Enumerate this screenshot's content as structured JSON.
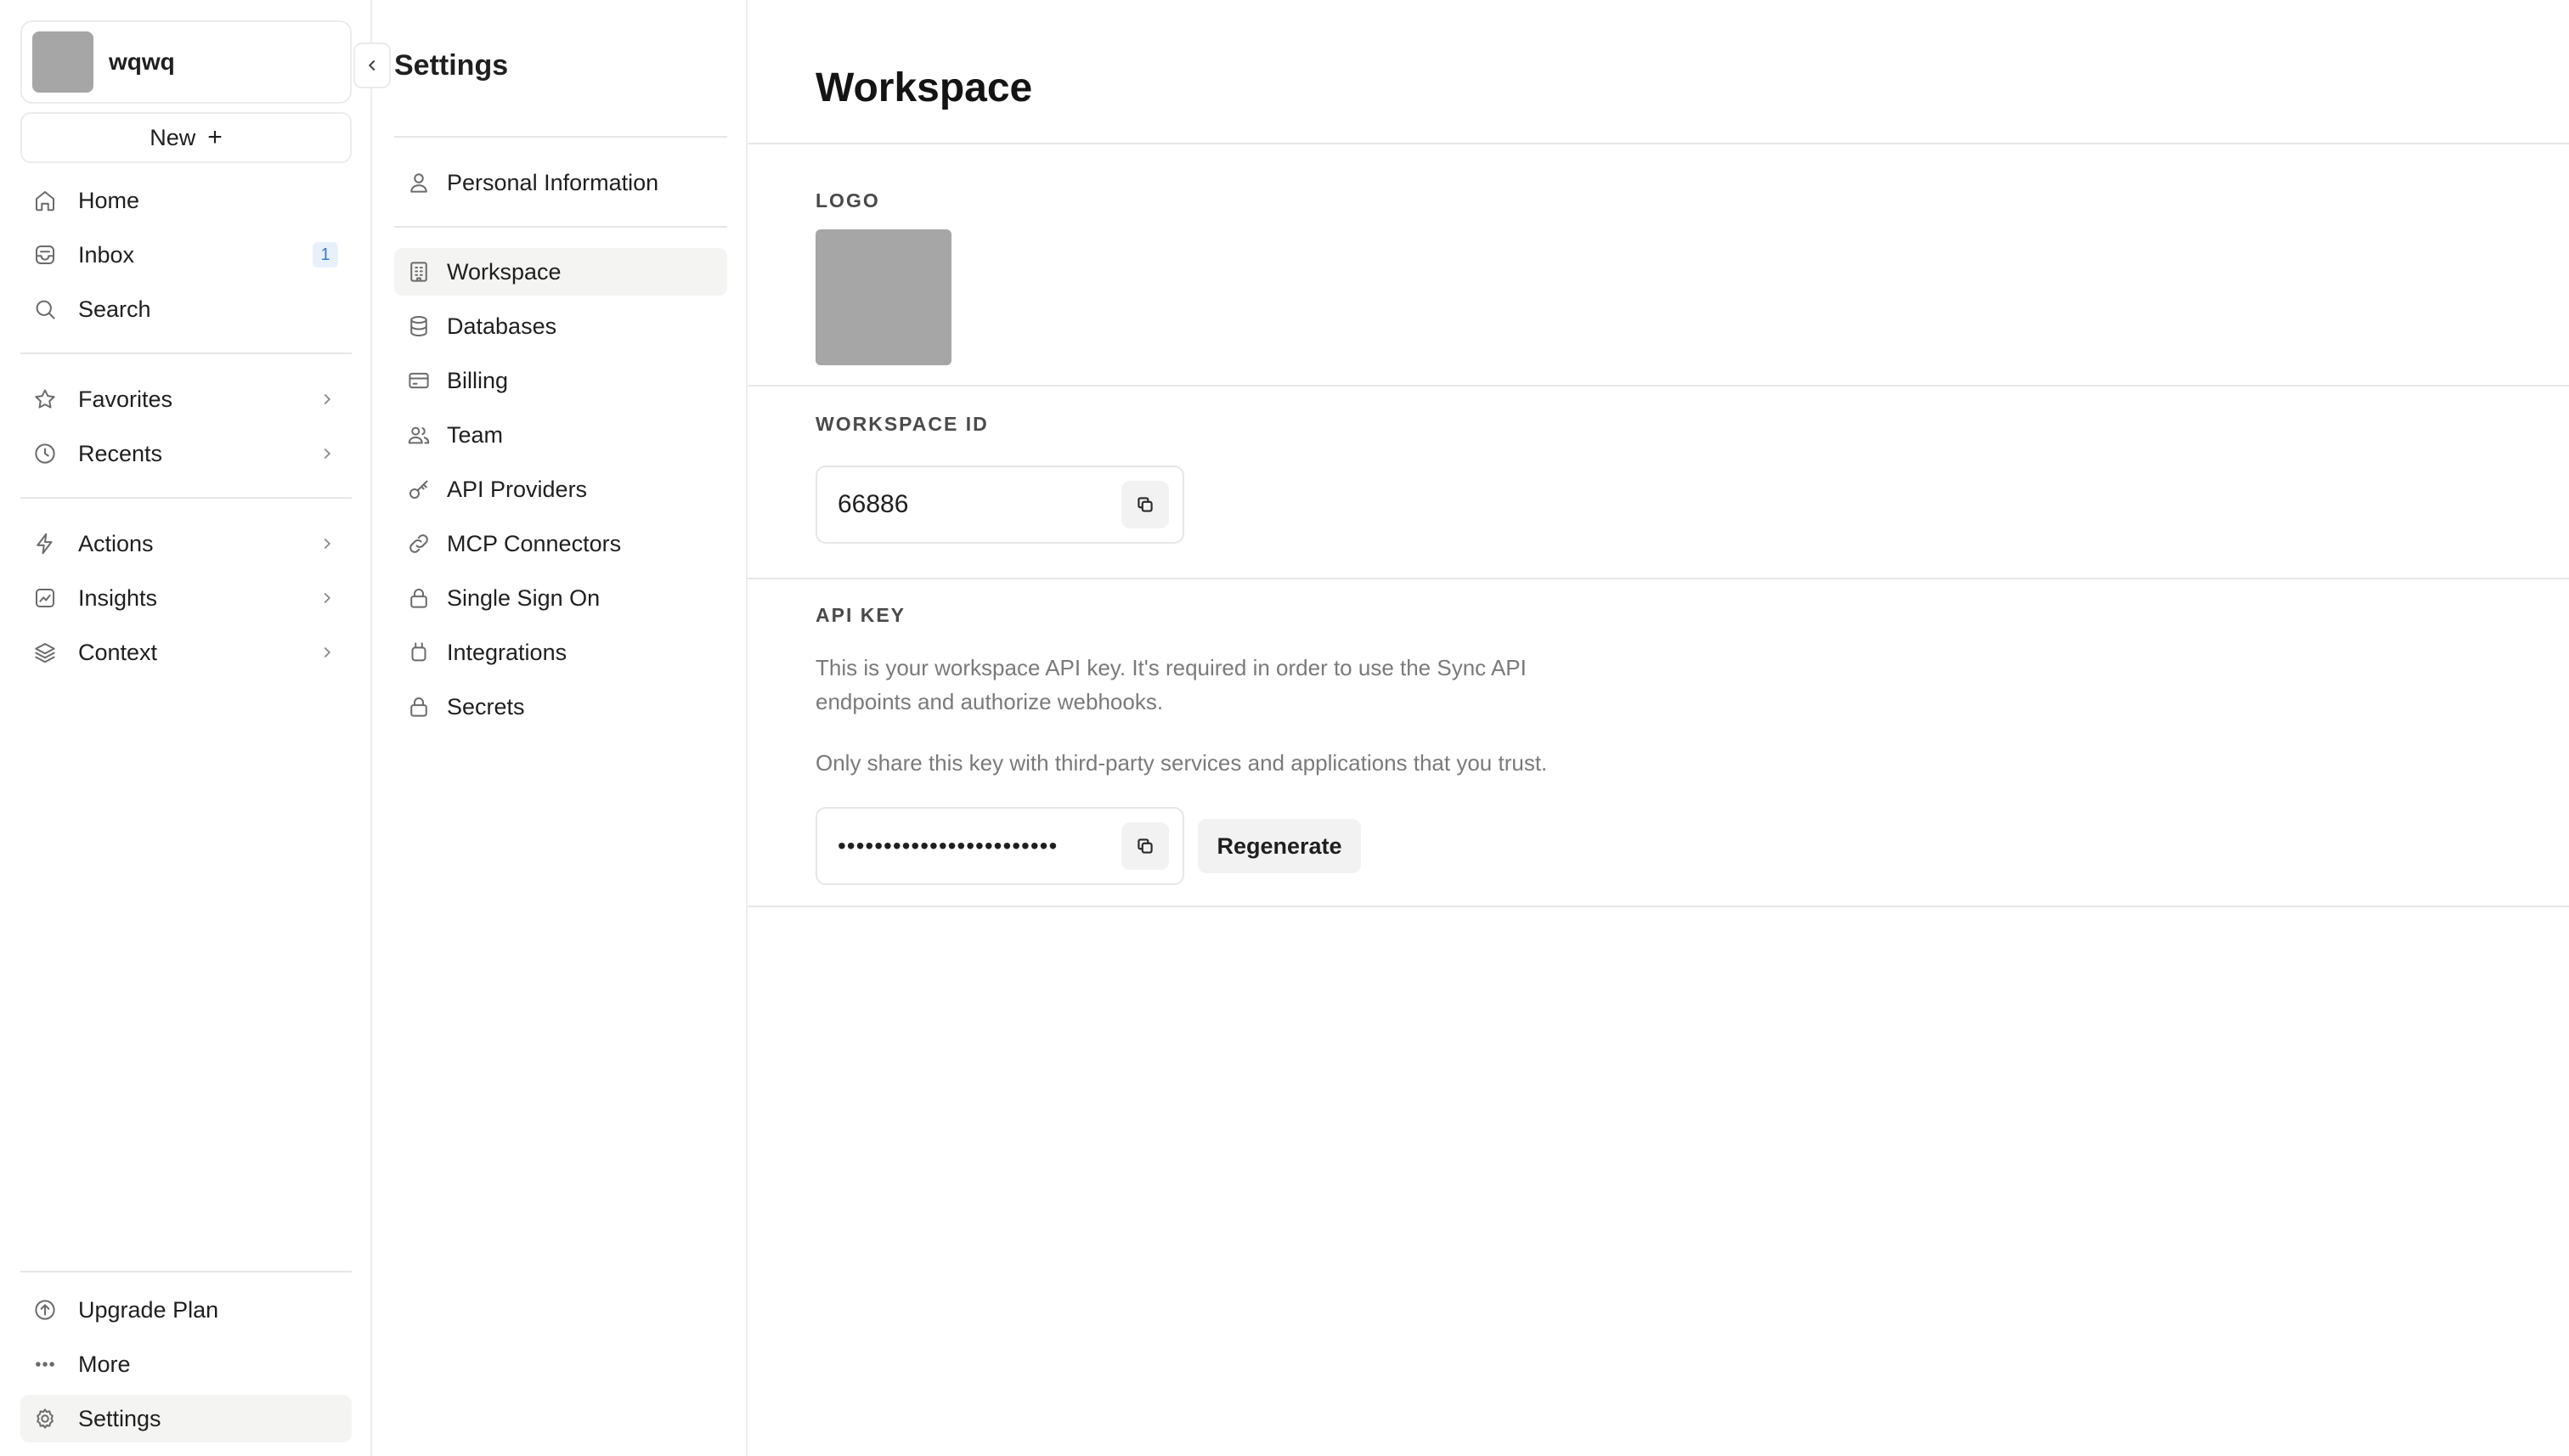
{
  "sidebar": {
    "workspace_name": "wqwq",
    "new_label": "New",
    "new_plus": "+",
    "primary": [
      {
        "label": "Home",
        "icon": "home-icon"
      },
      {
        "label": "Inbox",
        "icon": "inbox-icon",
        "badge": "1"
      },
      {
        "label": "Search",
        "icon": "search-icon"
      }
    ],
    "secondary": [
      {
        "label": "Favorites",
        "icon": "star-icon"
      },
      {
        "label": "Recents",
        "icon": "clock-icon"
      }
    ],
    "tertiary": [
      {
        "label": "Actions",
        "icon": "lightning-icon"
      },
      {
        "label": "Insights",
        "icon": "chart-icon"
      },
      {
        "label": "Context",
        "icon": "layers-icon"
      }
    ],
    "bottom": [
      {
        "label": "Upgrade Plan",
        "icon": "arrow-up-circle-icon"
      },
      {
        "label": "More",
        "icon": "more-dots-icon"
      },
      {
        "label": "Settings",
        "icon": "gear-icon"
      }
    ]
  },
  "settings_nav": {
    "title": "Settings",
    "items": [
      {
        "label": "Personal Information",
        "icon": "user-icon"
      },
      {
        "label": "Workspace",
        "icon": "building-icon"
      },
      {
        "label": "Databases",
        "icon": "database-icon"
      },
      {
        "label": "Billing",
        "icon": "credit-card-icon"
      },
      {
        "label": "Team",
        "icon": "users-icon"
      },
      {
        "label": "API Providers",
        "icon": "key-icon"
      },
      {
        "label": "MCP Connectors",
        "icon": "link-icon"
      },
      {
        "label": "Single Sign On",
        "icon": "lock-icon"
      },
      {
        "label": "Integrations",
        "icon": "plug-icon"
      },
      {
        "label": "Secrets",
        "icon": "lock-icon"
      }
    ],
    "active": "Workspace"
  },
  "main": {
    "title": "Workspace",
    "logo_label": "LOGO",
    "workspace_id_label": "WORKSPACE ID",
    "workspace_id_value": "66886",
    "api_key_label": "API KEY",
    "api_key_desc_1": "This is your workspace API key. It's required in order to use the Sync API",
    "api_key_desc_2": "endpoints and authorize webhooks.",
    "api_key_desc_3": "Only share this key with third-party services and applications that you trust.",
    "api_key_masked": "••••••••••••••••••••••••",
    "regenerate_label": "Regenerate"
  },
  "colors": {
    "active_bg": "#f4f4f2",
    "badge_bg": "#e8f1fb",
    "badge_text": "#3a78c8",
    "placeholder_gray": "#a6a6a6"
  }
}
